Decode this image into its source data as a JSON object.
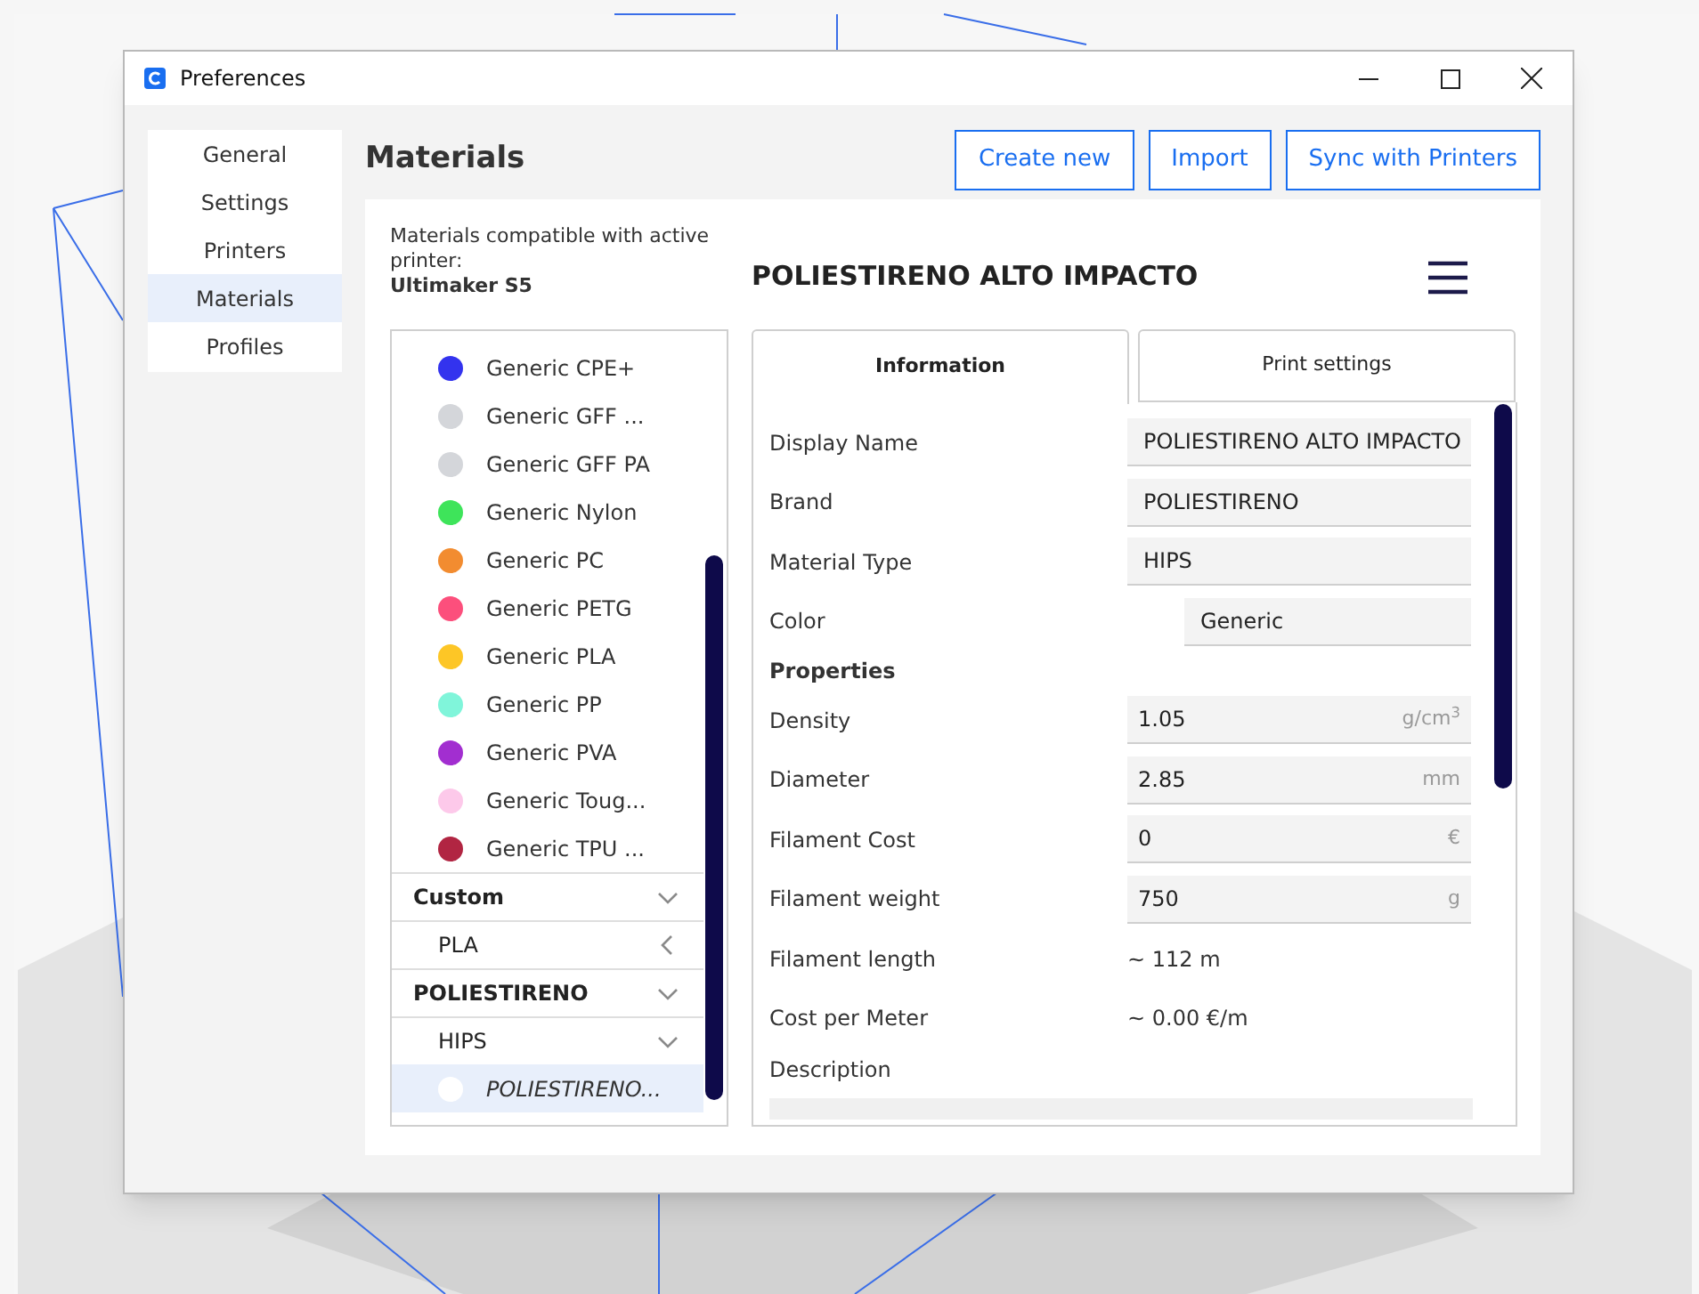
{
  "window": {
    "title": "Preferences"
  },
  "sidebar": {
    "items": [
      {
        "label": "General",
        "selected": false
      },
      {
        "label": "Settings",
        "selected": false
      },
      {
        "label": "Printers",
        "selected": false
      },
      {
        "label": "Materials",
        "selected": true
      },
      {
        "label": "Profiles",
        "selected": false
      }
    ]
  },
  "page": {
    "title": "Materials",
    "buttons": [
      "Create new",
      "Import",
      "Sync with Printers"
    ]
  },
  "compat": {
    "text": "Materials compatible with active printer:",
    "printer": "Ultimaker S5"
  },
  "materials": [
    {
      "kind": "material",
      "name": "Generic CPE+",
      "color": "#3333ee",
      "selected": false
    },
    {
      "kind": "material",
      "name": "Generic GFF ...",
      "color": "#d4d6da",
      "selected": false
    },
    {
      "kind": "material",
      "name": "Generic GFF PA",
      "color": "#d4d6da",
      "selected": false
    },
    {
      "kind": "material",
      "name": "Generic Nylon",
      "color": "#3ee45a",
      "selected": false
    },
    {
      "kind": "material",
      "name": "Generic PC",
      "color": "#f28c30",
      "selected": false
    },
    {
      "kind": "material",
      "name": "Generic PETG",
      "color": "#fc4f7c",
      "selected": false
    },
    {
      "kind": "material",
      "name": "Generic PLA",
      "color": "#fdc626",
      "selected": false
    },
    {
      "kind": "material",
      "name": "Generic PP",
      "color": "#80f5da",
      "selected": false
    },
    {
      "kind": "material",
      "name": "Generic PVA",
      "color": "#a22ed0",
      "selected": false
    },
    {
      "kind": "material",
      "name": "Generic Toug...",
      "color": "#fdc9ea",
      "selected": false
    },
    {
      "kind": "material",
      "name": "Generic TPU ...",
      "color": "#b12542",
      "selected": false
    },
    {
      "kind": "category",
      "name": "Custom",
      "expanded": true
    },
    {
      "kind": "subcategory",
      "name": "PLA",
      "expanded": false
    },
    {
      "kind": "category",
      "name": "POLIESTIRENO",
      "expanded": true
    },
    {
      "kind": "subcategory",
      "name": "HIPS",
      "expanded": true
    },
    {
      "kind": "material",
      "name": "POLIESTIRENO...",
      "color": "#ffffff",
      "selected": true
    }
  ],
  "detail": {
    "title": "POLIESTIRENO ALTO IMPACTO",
    "tabs": [
      {
        "label": "Information",
        "selected": true
      },
      {
        "label": "Print settings",
        "selected": false
      }
    ],
    "fields": [
      {
        "kind": "field",
        "label": "Display Name",
        "value": "POLIESTIRENO ALTO IMPACTO"
      },
      {
        "kind": "field",
        "label": "Brand",
        "value": "POLIESTIRENO"
      },
      {
        "kind": "field",
        "label": "Material Type",
        "value": "HIPS"
      },
      {
        "kind": "color",
        "label": "Color",
        "value": "Generic"
      },
      {
        "kind": "heading",
        "label": "Properties"
      },
      {
        "kind": "unit",
        "label": "Density",
        "value": "1.05",
        "unit": "g/cm$^{3}$"
      },
      {
        "kind": "unit",
        "label": "Diameter",
        "value": "2.85",
        "unit": "mm"
      },
      {
        "kind": "unit",
        "label": "Filament Cost",
        "value": "0",
        "unit": "€"
      },
      {
        "kind": "unit",
        "label": "Filament weight",
        "value": "750",
        "unit": "g"
      },
      {
        "kind": "text",
        "label": "Filament length",
        "value": "~ 112 m"
      },
      {
        "kind": "text",
        "label": "Cost per Meter",
        "value": "~ 0.00 €/m"
      },
      {
        "kind": "description",
        "label": "Description"
      }
    ]
  }
}
